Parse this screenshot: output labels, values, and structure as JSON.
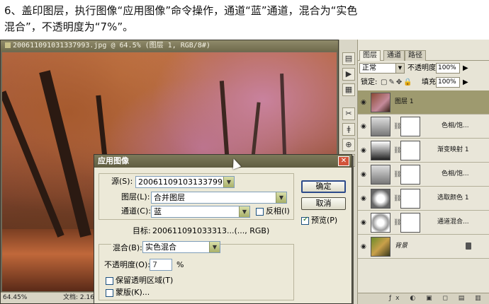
{
  "caption": {
    "line1": "6、盖印图层，执行图像“应用图像”命令操作，通道“蓝”通道，混合为“实色",
    "line2": "混合”，不透明度为“7%”。"
  },
  "document": {
    "title": "200611091031337993.jpg @ 64.5% (图层 1, RGB/8#)",
    "zoom": "64.45%",
    "doc_size": "文档: 2.16M/4"
  },
  "layers_panel": {
    "tabs": [
      "图层",
      "通道",
      "路径"
    ],
    "blend_mode": "正常",
    "opacity_label": "不透明度:",
    "opacity_value": "100%",
    "lock_label": "锁定:",
    "fill_label": "填充:",
    "fill_value": "100%",
    "layers": [
      {
        "name": "图层 1",
        "selected": true,
        "has_mask": false
      },
      {
        "name": "色相/饱...",
        "selected": false,
        "has_mask": true
      },
      {
        "name": "渐变映射 1",
        "selected": false,
        "has_mask": true
      },
      {
        "name": "色相/饱...",
        "selected": false,
        "has_mask": true
      },
      {
        "name": "选取颜色 1",
        "selected": false,
        "has_mask": true
      },
      {
        "name": "通道混合...",
        "selected": false,
        "has_mask": true
      },
      {
        "name": "背景",
        "selected": false,
        "has_mask": false,
        "locked": true
      }
    ],
    "bottom_icons": "ƒx ◐ ▣ ◻ ▤ ▥ 🗑"
  },
  "dialog": {
    "title": "应用图像",
    "source_label": "源(S):",
    "source_value": "200611091031337993...",
    "layer_label": "图层(L):",
    "layer_value": "合并图层",
    "channel_label": "通道(C):",
    "channel_value": "蓝",
    "invert_label": "反相(I)",
    "target_label": "目标:",
    "target_value": "200611091033313...(..., RGB)",
    "blending_label": "混合(B):",
    "blending_value": "实色混合",
    "opacity_label": "不透明度(O):",
    "opacity_value": "7",
    "opacity_unit": "%",
    "preserve_label": "保留透明区域(T)",
    "mask_label": "蒙版(K)...",
    "ok_label": "确定",
    "cancel_label": "取消",
    "preview_label": "预览(P)",
    "preview_checked": true,
    "invert_checked": false,
    "preserve_checked": false,
    "mask_checked": false
  }
}
